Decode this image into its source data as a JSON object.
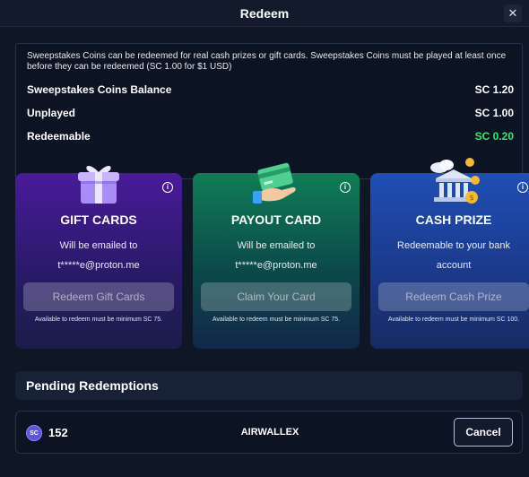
{
  "header": {
    "title": "Redeem",
    "close_glyph": "✕"
  },
  "balance": {
    "intro": "Sweepstakes Coins can be redeemed for real cash prizes or gift cards. Sweepstakes Coins must be played at least once before they can be redeemed (SC 1.00 for $1 USD)",
    "rows": [
      {
        "label": "Sweepstakes Coins Balance",
        "value": "SC 1.20"
      },
      {
        "label": "Unplayed",
        "value": "SC 1.00"
      },
      {
        "label": "Redeemable",
        "value": "SC 0.20",
        "color": "#32e86b"
      }
    ]
  },
  "cards": [
    {
      "icon": "gift-box-icon",
      "title": "GIFT CARDS",
      "line1": "Will be emailed to",
      "line2": "t*****e@proton.me",
      "button": "Redeem Gift Cards",
      "note": "Available to redeem must be minimum SC 75."
    },
    {
      "icon": "card-hand-icon",
      "title": "PAYOUT CARD",
      "line1": "Will be emailed to",
      "line2": "t*****e@proton.me",
      "button": "Claim Your Card",
      "note": "Available to redeem must be minimum SC 75."
    },
    {
      "icon": "bank-coins-icon",
      "title": "CASH PRIZE",
      "line1": "Redeemable to your bank",
      "line2": "account",
      "button": "Redeem Cash Prize",
      "note": "Available to redeem must be minimum SC 100."
    }
  ],
  "info_glyph": "i",
  "pending": {
    "title": "Pending Redemptions",
    "items": [
      {
        "badge": "SC",
        "amount": "152",
        "provider": "AIRWALLEX",
        "action": "Cancel"
      }
    ]
  }
}
